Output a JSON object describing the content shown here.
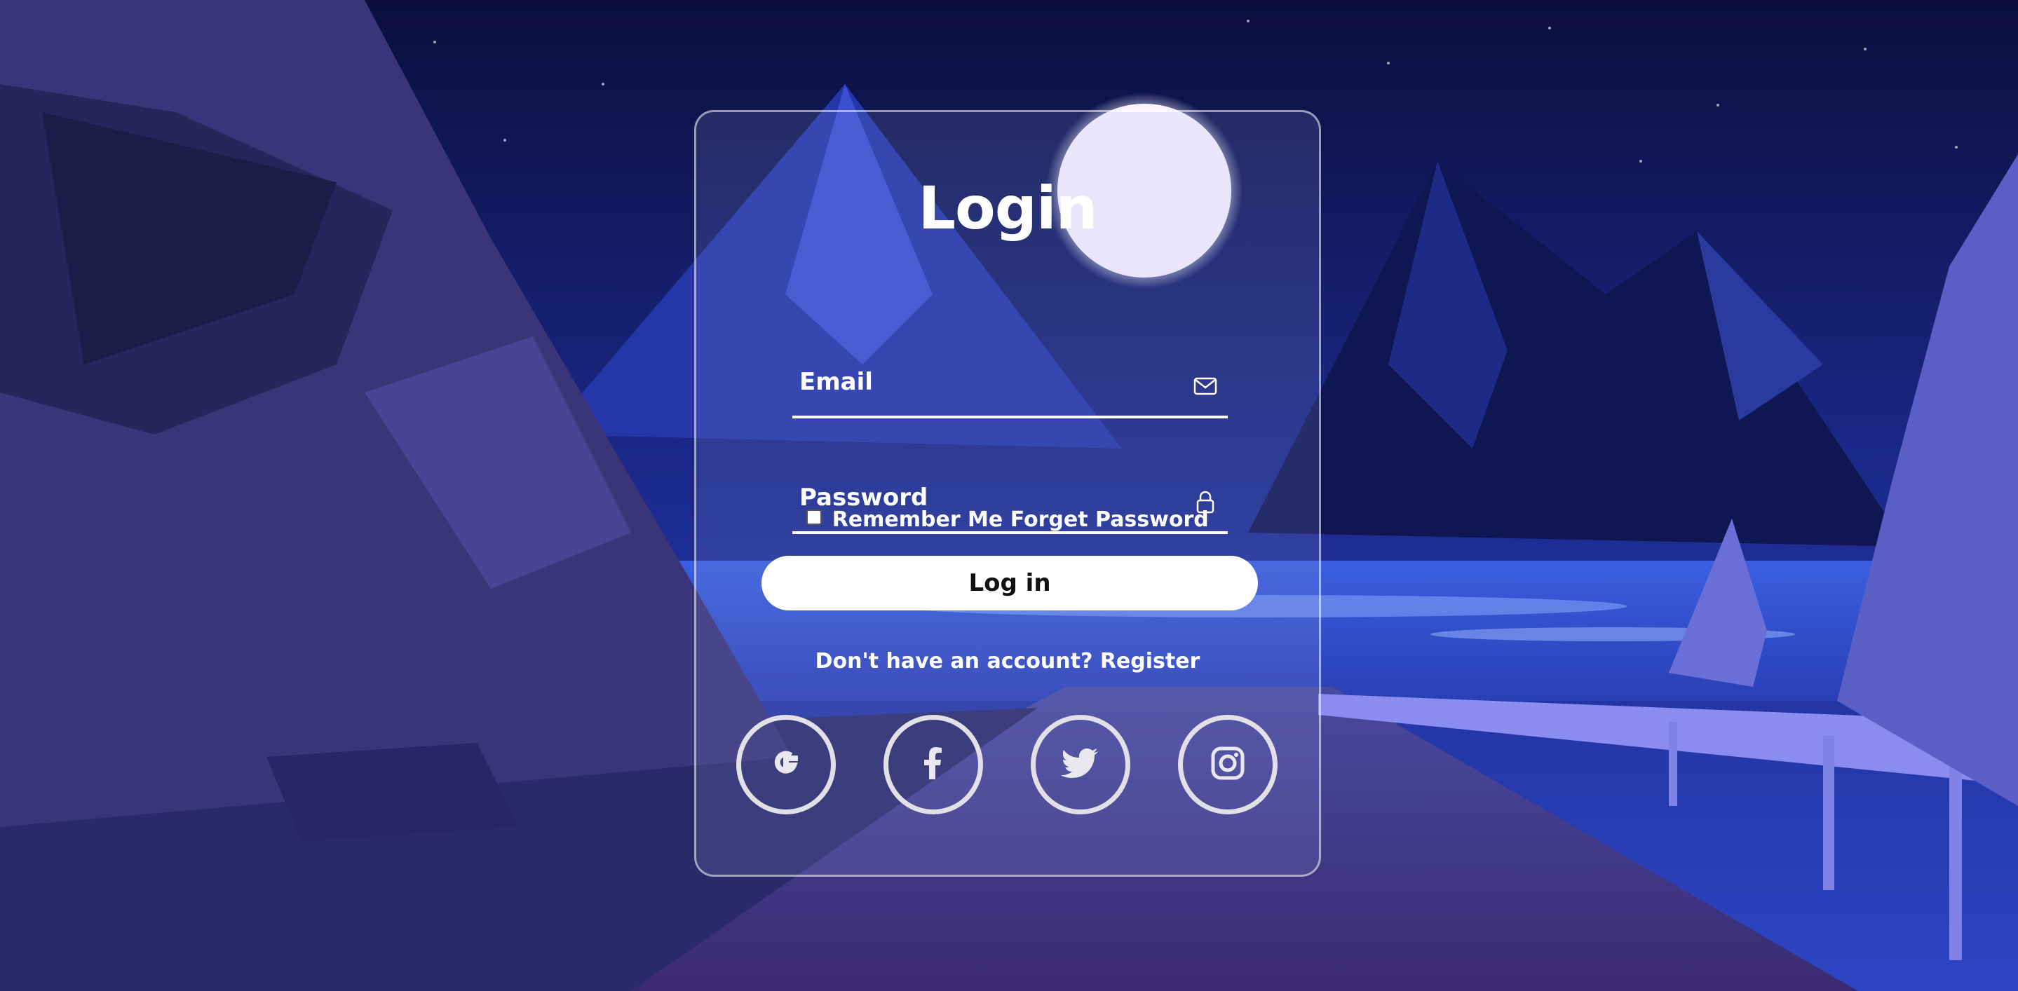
{
  "login": {
    "title": "Login",
    "email_placeholder": "Email",
    "password_placeholder": "Password",
    "remember_label": "Remember Me",
    "forget_label": "Forget Password",
    "login_button": "Log in",
    "register_prompt": "Don't have an account?",
    "register_link": "Register"
  },
  "socials": [
    {
      "icon": "google-icon"
    },
    {
      "icon": "facebook-icon"
    },
    {
      "icon": "twitter-icon"
    },
    {
      "icon": "instagram-icon"
    }
  ],
  "colors": {
    "sky": "#0c1140",
    "accent": "#ffffff",
    "card_border": "#d8dcf0"
  }
}
